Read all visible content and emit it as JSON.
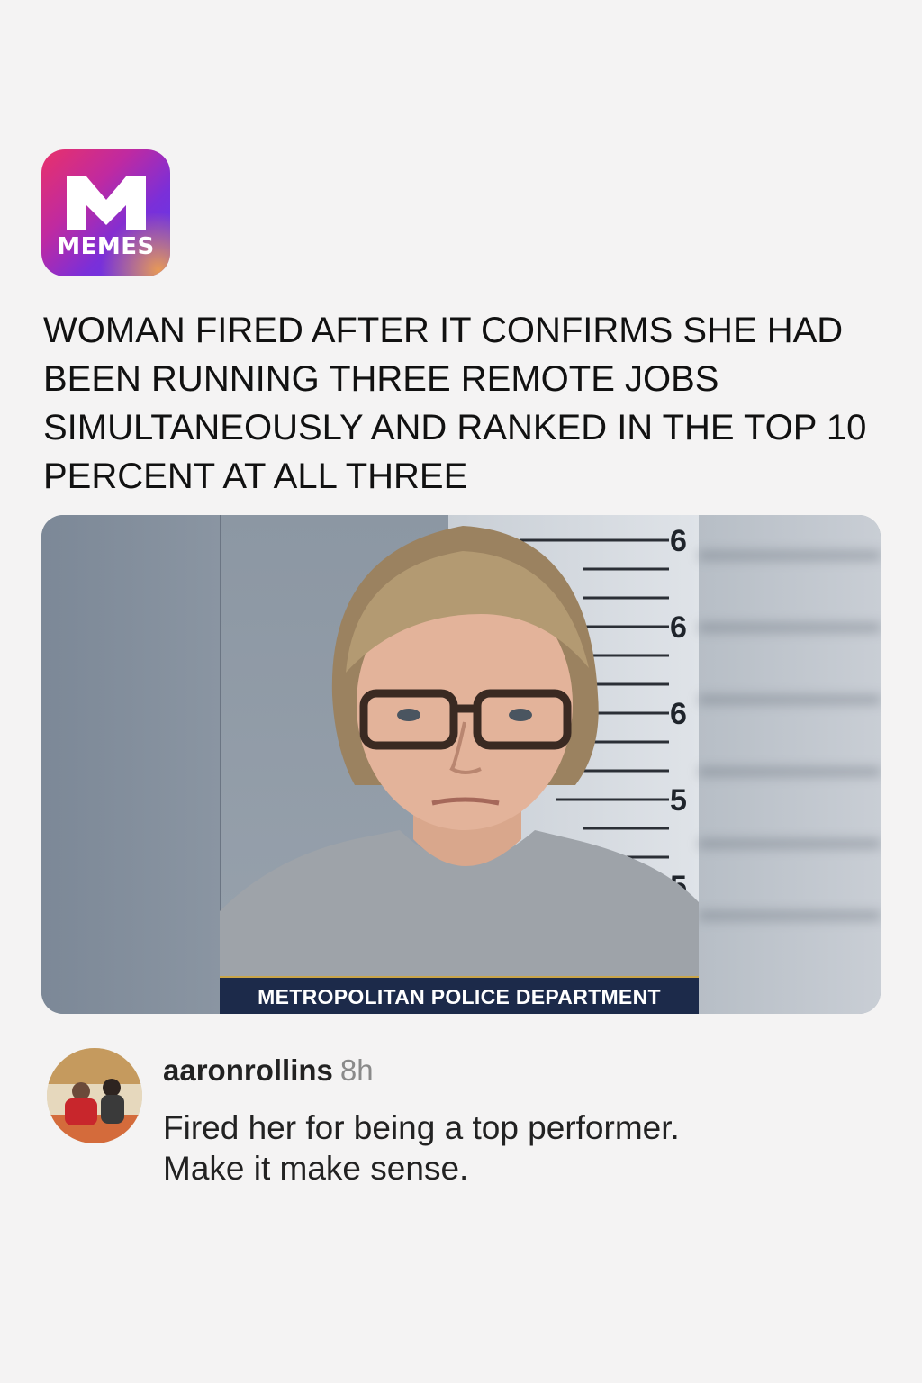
{
  "brand": {
    "logo_letter": "M",
    "logo_text": "MEMES",
    "gradient_colors": [
      "#e8316a",
      "#c02aa0",
      "#7b2fd8",
      "#5b3cf0"
    ]
  },
  "post": {
    "headline": "WOMAN FIRED AFTER IT CONFIRMS SHE HAD BEEN RUNNING THREE REMOTE JOBS SIMULTANEOUSLY AND RANKED IN THE TOP 10 PERCENT AT ALL THREE",
    "image": {
      "caption": "METROPOLITAN POLICE DEPARTMENT",
      "ruler_labels": [
        "6",
        "6",
        "6",
        "5",
        "5"
      ]
    }
  },
  "comment": {
    "username": "aaronrollins",
    "timestamp": "8h",
    "text_lines": [
      "Fired her for being a top performer.",
      "Make it make sense."
    ]
  }
}
